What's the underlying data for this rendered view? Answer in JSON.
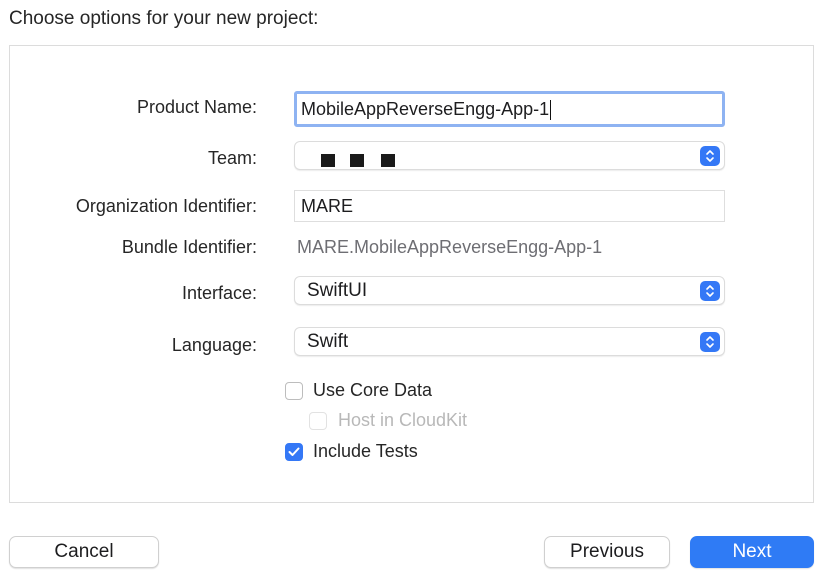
{
  "heading": "Choose options for your new project:",
  "form": {
    "product_name_label": "Product Name:",
    "product_name_value": "MobileAppReverseEngg-App-1",
    "team_label": "Team:",
    "org_id_label": "Organization Identifier:",
    "org_id_value": "MARE",
    "bundle_id_label": "Bundle Identifier:",
    "bundle_id_value": "MARE.MobileAppReverseEngg-App-1",
    "interface_label": "Interface:",
    "interface_value": "SwiftUI",
    "language_label": "Language:",
    "language_value": "Swift"
  },
  "checkboxes": {
    "core_data": {
      "label": "Use Core Data",
      "checked": false
    },
    "cloudkit": {
      "label": "Host in CloudKit",
      "checked": false,
      "disabled": true
    },
    "tests": {
      "label": "Include Tests",
      "checked": true
    }
  },
  "buttons": {
    "cancel": "Cancel",
    "previous": "Previous",
    "next": "Next"
  },
  "colors": {
    "accent": "#3478f6",
    "focus_ring": "#8eb3f2"
  }
}
